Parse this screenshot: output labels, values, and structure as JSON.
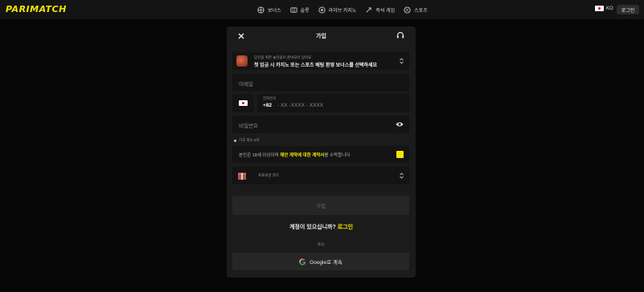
{
  "header": {
    "logo": "PARIMATCH",
    "nav": [
      {
        "label": "보너스",
        "icon": "gift-icon"
      },
      {
        "label": "슬롯",
        "icon": "slot-icon"
      },
      {
        "label": "라이브 카지노",
        "icon": "live-casino-icon"
      },
      {
        "label": "즉석 게임",
        "icon": "rocket-icon"
      },
      {
        "label": "스포츠",
        "icon": "ball-icon"
      }
    ],
    "lang": "KO",
    "login": "로그인"
  },
  "modal": {
    "title": "가입",
    "bonus": {
      "subtitle": "당신을 위한 놀라움이 준비되어 있어요",
      "label": "첫 입금 시 카지노 또는 스포츠 베팅 환영 보너스를 선택하세요"
    },
    "email_placeholder": "이메일",
    "phone": {
      "label": "전화번호",
      "code": "+82",
      "placeholder": "- XX -XXXX - XXXX"
    },
    "password_placeholder": "비밀번호",
    "password_hint": "기호 최소 6자",
    "terms": {
      "prefix": "본인은 18세 이상이며 ",
      "highlight": "제안 계약에 대한 계약서",
      "suffix": "를 수락합니다"
    },
    "promo_label": "프로모션 코드",
    "submit": "가입",
    "have_account": "계정이 있으십니까?",
    "login_link": "로그인",
    "or": "또는",
    "google": "Google로 계속"
  },
  "colors": {
    "accent": "#f3e600",
    "background": "#060606",
    "panel": "#1b1b1b"
  }
}
